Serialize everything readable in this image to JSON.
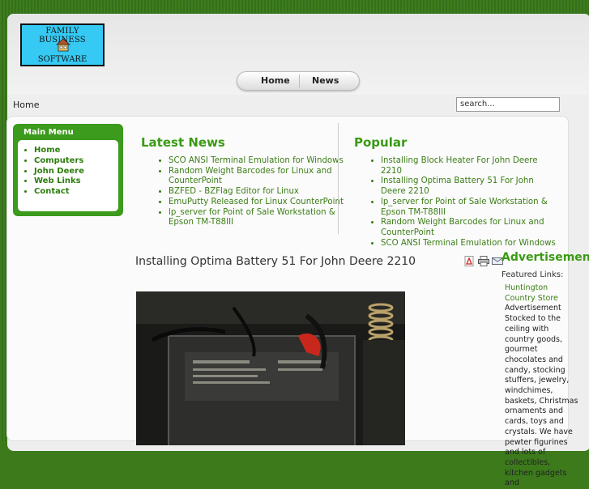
{
  "logo": {
    "line1": "FAMILY BUSINESS",
    "line2": "SOFTWARE"
  },
  "nav": {
    "items": [
      "Home",
      "News"
    ]
  },
  "breadcrumb": "Home",
  "search": {
    "value": "search..."
  },
  "main_menu": {
    "title": "Main Menu",
    "items": [
      "Home",
      "Computers",
      "John Deere",
      "Web Links",
      "Contact"
    ]
  },
  "latest_news": {
    "title": "Latest News",
    "items": [
      "SCO ANSI Terminal Emulation for Windows",
      "Random Weight Barcodes for Linux and CounterPoint",
      "BZFED - BZFlag Editor for Linux",
      "EmuPutty Released for Linux CounterPoint",
      "lp_server for Point of Sale Workstation & Epson TM-T88III"
    ]
  },
  "popular": {
    "title": "Popular",
    "items": [
      "Installing Block Heater For John Deere 2210",
      "Installing Optima Battery 51 For John Deere 2210",
      "lp_server for Point of Sale Workstation & Epson TM-T88III",
      "Random Weight Barcodes for Linux and CounterPoint",
      "SCO ANSI Terminal Emulation for Windows"
    ]
  },
  "article": {
    "title": "Installing Optima Battery 51 For John Deere 2210",
    "icons": [
      "pdf-icon",
      "print-icon",
      "email-icon"
    ]
  },
  "ads": {
    "heading": "Advertisement",
    "subheading": "Featured Links:",
    "link_text": "Huntington Country Store",
    "body": "Advertisement Stocked to the ceiling with country goods, gourmet chocolates and candy, stocking stuffers, jewelry, windchimes, baskets, Christmas ornaments and cards, toys and crystals. We have pewter figurines and lots of collectibles, kitchen gadgets and"
  },
  "colors": {
    "background": "#3c7a1c",
    "accent": "#3a9a14",
    "link": "#3b7d16",
    "logo_bg": "#35c9f3"
  }
}
